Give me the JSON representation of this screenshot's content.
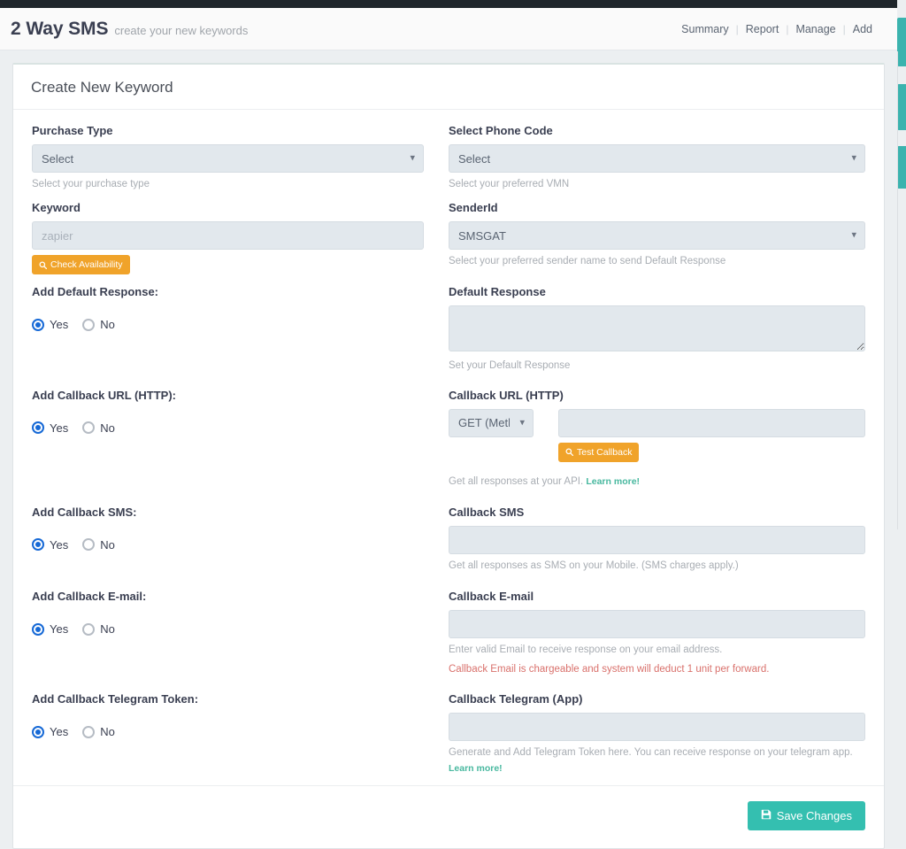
{
  "header": {
    "title": "2 Way SMS",
    "subtitle": "create your new keywords",
    "nav": [
      {
        "label": "Summary"
      },
      {
        "label": "Report"
      },
      {
        "label": "Manage"
      },
      {
        "label": "Add"
      }
    ],
    "separator": "|"
  },
  "card": {
    "title": "Create New Keyword"
  },
  "fields": {
    "purchase_type": {
      "label": "Purchase Type",
      "value": "Select",
      "hint": "Select your purchase type"
    },
    "phone_code": {
      "label": "Select Phone Code",
      "value": "Select",
      "hint": "Select your preferred VMN"
    },
    "keyword": {
      "label": "Keyword",
      "value": "",
      "placeholder": "zapier",
      "button_label": "Check Availability"
    },
    "sender_id": {
      "label": "SenderId",
      "value": "SMSGAT",
      "hint": "Select your preferred sender name to send Default Response"
    },
    "add_default_response": {
      "label": "Add Default Response:",
      "yes": "Yes",
      "no": "No",
      "selected": "Yes"
    },
    "default_response": {
      "label": "Default Response",
      "value": "",
      "hint": "Set your Default Response"
    },
    "add_callback_url": {
      "label": "Add Callback URL (HTTP):",
      "yes": "Yes",
      "no": "No",
      "selected": "Yes"
    },
    "callback_url": {
      "label": "Callback URL (HTTP)",
      "method_value": "GET (Method)",
      "value": "",
      "button_label": "Test Callback",
      "hint": "Get all responses at your API.",
      "link_label": "Learn more!"
    },
    "add_callback_sms": {
      "label": "Add Callback SMS:",
      "yes": "Yes",
      "no": "No",
      "selected": "Yes"
    },
    "callback_sms": {
      "label": "Callback SMS",
      "value": "",
      "hint": "Get all responses as SMS on your Mobile. (SMS charges apply.)"
    },
    "add_callback_email": {
      "label": "Add Callback E-mail:",
      "yes": "Yes",
      "no": "No",
      "selected": "Yes"
    },
    "callback_email": {
      "label": "Callback E-mail",
      "value": "",
      "hint": "Enter valid Email to receive response on your email address.",
      "warning": "Callback Email is chargeable and system will deduct 1 unit per forward."
    },
    "add_callback_telegram": {
      "label": "Add Callback Telegram Token:",
      "yes": "Yes",
      "no": "No",
      "selected": "Yes"
    },
    "callback_telegram": {
      "label": "Callback Telegram (App)",
      "value": "",
      "hint": "Generate and Add Telegram Token here. You can receive response on your telegram app.",
      "link_label": "Learn more!"
    }
  },
  "footer": {
    "save_label": "Save Changes"
  },
  "icons": {
    "search": "search-icon",
    "save": "save-icon",
    "chevron_down": "chevron-down-icon"
  },
  "colors": {
    "accent_teal": "#34bfb0",
    "accent_orange": "#f0a32a",
    "link_green": "#48b89f",
    "warning_red": "#d9706b",
    "radio_blue": "#1669d6",
    "navbar_dark": "#1f262b"
  }
}
